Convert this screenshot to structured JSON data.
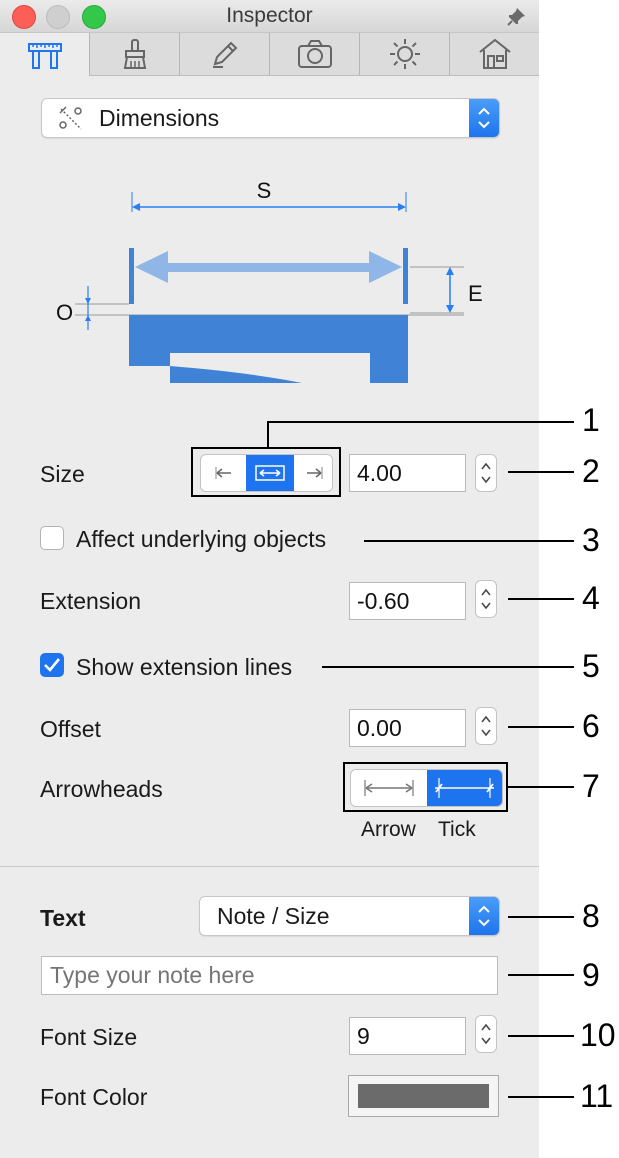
{
  "window": {
    "title": "Inspector"
  },
  "tabs": [
    {
      "icon": "dimension-tool-icon",
      "selected": true
    },
    {
      "icon": "brush-icon",
      "selected": false
    },
    {
      "icon": "pencil-icon",
      "selected": false
    },
    {
      "icon": "camera-icon",
      "selected": false
    },
    {
      "icon": "sun-icon",
      "selected": false
    },
    {
      "icon": "house-icon",
      "selected": false
    }
  ],
  "mode_select": {
    "value": "Dimensions"
  },
  "diagram": {
    "s_label": "S",
    "e_label": "E",
    "o_label": "O"
  },
  "size": {
    "label": "Size",
    "value": "4.00",
    "alignment_selected": "center"
  },
  "affect": {
    "label": "Affect underlying objects",
    "checked": false
  },
  "extension": {
    "label": "Extension",
    "value": "-0.60"
  },
  "show_ext": {
    "label": "Show extension lines",
    "checked": true
  },
  "offset": {
    "label": "Offset",
    "value": "0.00"
  },
  "arrowheads": {
    "label": "Arrowheads",
    "options": [
      "Arrow",
      "Tick"
    ],
    "selected": "Tick"
  },
  "text": {
    "label": "Text",
    "select_value": "Note / Size",
    "note_placeholder": "Type your note here"
  },
  "font_size": {
    "label": "Font Size",
    "value": "9"
  },
  "font_color": {
    "label": "Font Color",
    "color": "#6b6b6b"
  },
  "callouts": [
    "1",
    "2",
    "3",
    "4",
    "5",
    "6",
    "7",
    "8",
    "9",
    "10",
    "11"
  ],
  "colors": {
    "accent": "#2a7ef4",
    "diagram_light": "#8fb6e6",
    "diagram_dark": "#3f82d6"
  }
}
